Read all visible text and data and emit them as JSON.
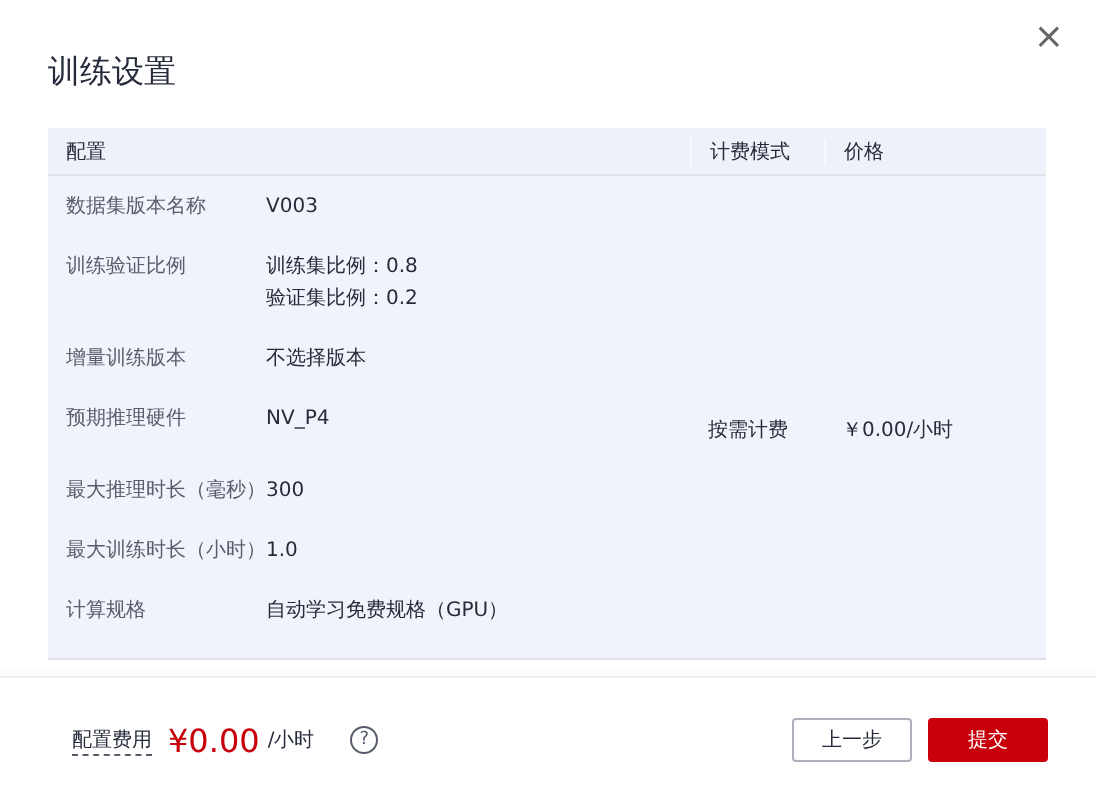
{
  "dialog": {
    "title": "训练设置",
    "close": "×"
  },
  "table": {
    "columns": [
      "配置",
      "计费模式",
      "价格"
    ],
    "rows": [
      {
        "label": "数据集版本名称",
        "values": [
          "V003"
        ]
      },
      {
        "label": "训练验证比例",
        "values": [
          "训练集比例：0.8",
          "验证集比例：0.2"
        ]
      },
      {
        "label": "增量训练版本",
        "values": [
          "不选择版本"
        ]
      },
      {
        "label": "预期推理硬件",
        "values": [
          "NV_P4"
        ],
        "billing": "按需计费",
        "price": "￥0.00/小时"
      },
      {
        "label": "最大推理时长（毫秒）",
        "values": [
          "300"
        ]
      },
      {
        "label": "最大训练时长（小时）",
        "values": [
          "1.0"
        ]
      },
      {
        "label": "计算规格",
        "values": [
          "自动学习免费规格（GPU）"
        ]
      }
    ]
  },
  "footer": {
    "fee_label": "配置费用",
    "fee_amount": "¥0.00",
    "fee_unit": "/小时",
    "help": "?",
    "buttons": [
      {
        "label": "上一步",
        "kind": "secondary"
      },
      {
        "label": "提交",
        "kind": "primary"
      }
    ]
  }
}
